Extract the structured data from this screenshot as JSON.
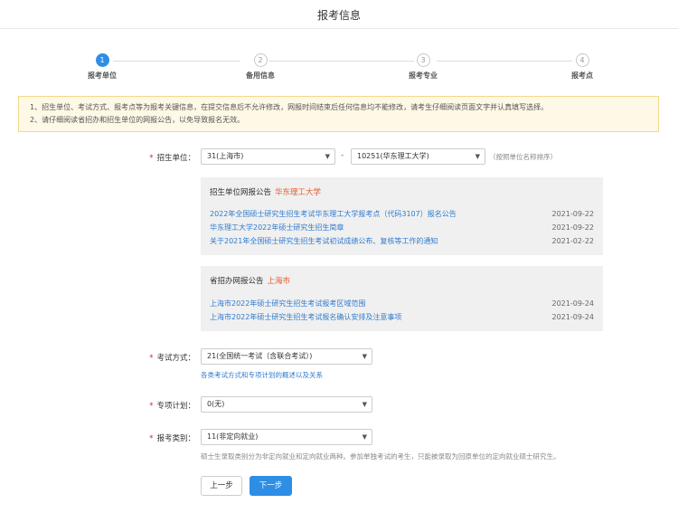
{
  "page_title": "报考信息",
  "steps": [
    {
      "num": "1",
      "label": "报考单位"
    },
    {
      "num": "2",
      "label": "备用信息"
    },
    {
      "num": "3",
      "label": "报考专业"
    },
    {
      "num": "4",
      "label": "报考点"
    }
  ],
  "notice": {
    "line1": "1、招生单位、考试方式、报考点等为报考关键信息，在提交信息后不允许修改，网报时间结束后任何信息均不能修改，请考生仔细阅读页面文字并认真填写选择。",
    "line2": "2、请仔细阅读省招办和招生单位的网报公告，以免导致报名无效。"
  },
  "form": {
    "unit_label": "招生单位：",
    "province_value": "31(上海市)",
    "dash": "-",
    "school_value": "10251(华东理工大学)",
    "unit_hint": "（按照单位名称排序）",
    "mode_label": "考试方式：",
    "mode_value": "21(全国统一考试（含联合考试）)",
    "mode_link": "各类考试方式和专项计划的概述以及关系",
    "plan_label": "专项计划：",
    "plan_value": "0(无)",
    "type_label": "报考类别：",
    "type_value": "11(非定向就业)",
    "type_hint": "硕士生录取类别分为非定向就业和定向就业两种。参加单独考试的考生，只能被录取为回原单位的定向就业硕士研究生。"
  },
  "school_notice": {
    "head": "招生单位网报公告",
    "school": "华东理工大学",
    "items": [
      {
        "title": "2022年全国硕士研究生招生考试华东理工大学报考点（代码3107）报名公告",
        "date": "2021-09-22"
      },
      {
        "title": "华东理工大学2022年硕士研究生招生简章",
        "date": "2021-09-22"
      },
      {
        "title": "关于2021年全国硕士研究生招生考试初试成绩公布、复核等工作的通知",
        "date": "2021-02-22"
      }
    ]
  },
  "province_notice": {
    "head": "省招办网报公告",
    "province": "上海市",
    "items": [
      {
        "title": "上海市2022年硕士研究生招生考试报考区域范围",
        "date": "2021-09-24"
      },
      {
        "title": "上海市2022年硕士研究生招生考试报名确认安排及注意事项",
        "date": "2021-09-24"
      }
    ]
  },
  "buttons": {
    "prev": "上一步",
    "next": "下一步"
  },
  "icons": {
    "caret": "caret-down-icon"
  },
  "colors": {
    "accent": "#2e8ee6",
    "link": "#2e7bd0",
    "highlight": "#e55b2e",
    "required": "#e02020",
    "notice_bg": "#fef8e6"
  }
}
